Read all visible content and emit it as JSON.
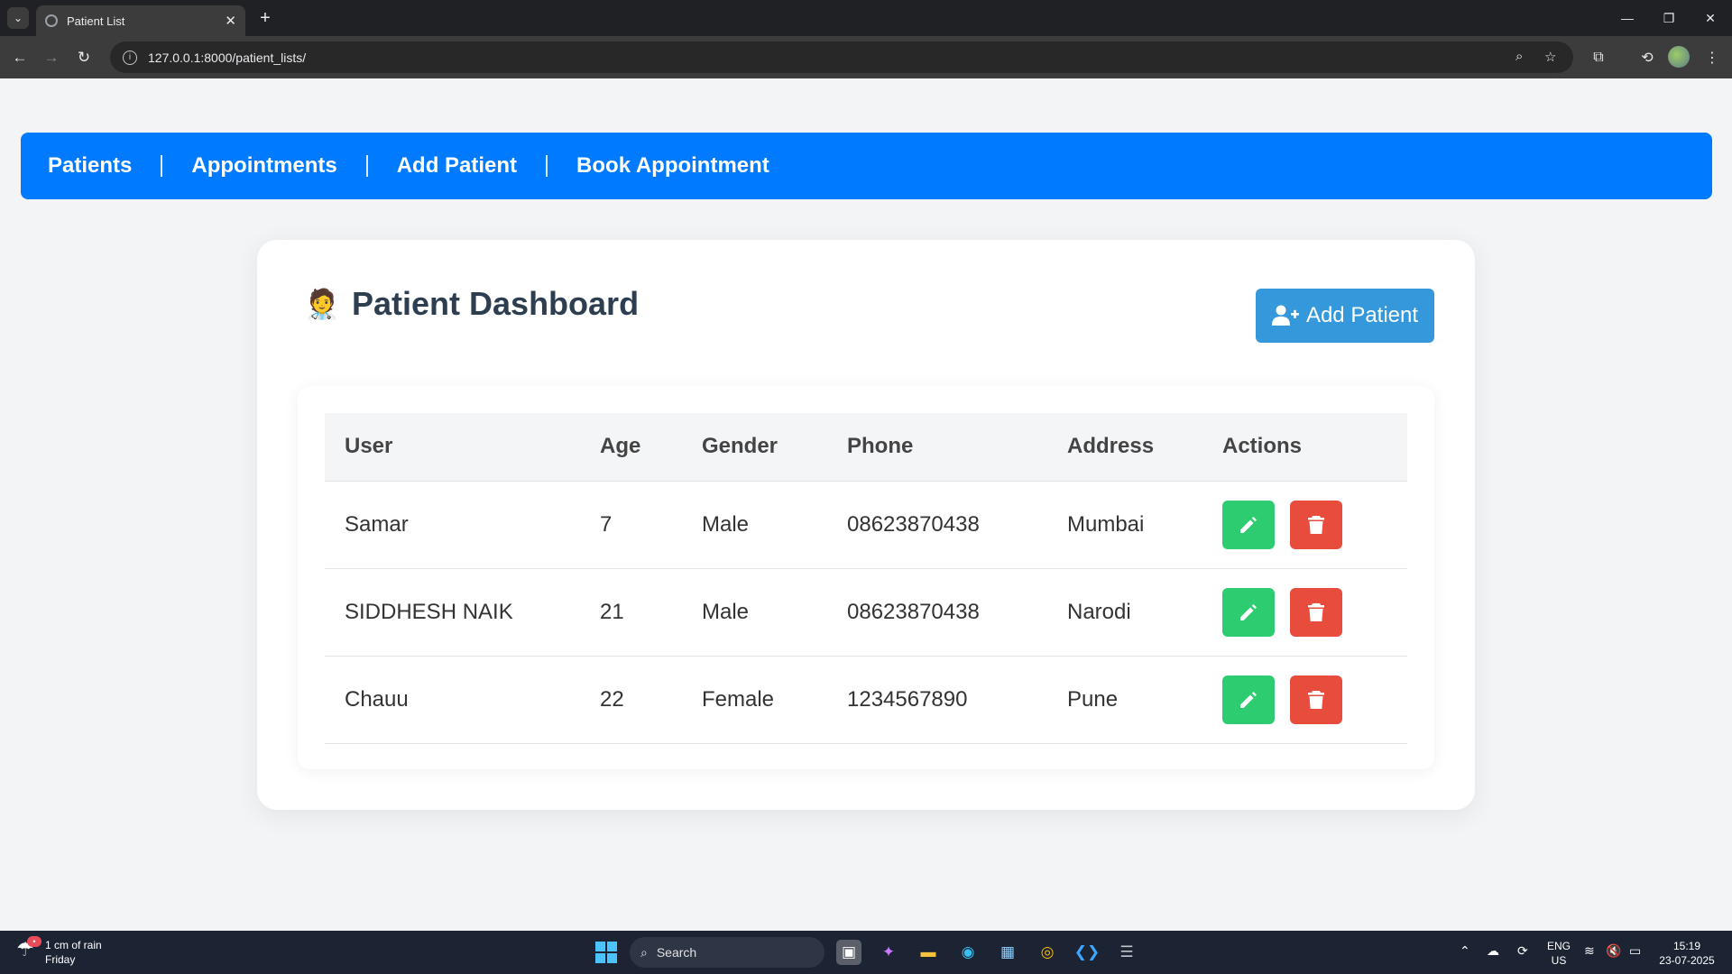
{
  "browser": {
    "tab_title": "Patient List",
    "url": "127.0.0.1:8000/patient_lists/"
  },
  "nav": {
    "items": [
      {
        "label": "Patients"
      },
      {
        "label": "Appointments"
      },
      {
        "label": "Add Patient"
      },
      {
        "label": "Book Appointment"
      }
    ]
  },
  "dashboard": {
    "emoji": "🧑‍⚕️",
    "title": "Patient Dashboard",
    "add_button": "Add Patient"
  },
  "table": {
    "headers": [
      "User",
      "Age",
      "Gender",
      "Phone",
      "Address",
      "Actions"
    ],
    "rows": [
      {
        "user": "Samar",
        "age": "7",
        "gender": "Male",
        "phone": "08623870438",
        "address": "Mumbai"
      },
      {
        "user": "SIDDHESH NAIK",
        "age": "21",
        "gender": "Male",
        "phone": "08623870438",
        "address": "Narodi"
      },
      {
        "user": "Chauu",
        "age": "22",
        "gender": "Female",
        "phone": "1234567890",
        "address": "Pune"
      }
    ]
  },
  "taskbar": {
    "weather_line1": "1 cm of rain",
    "weather_line2": "Friday",
    "search_label": "Search",
    "lang_line1": "ENG",
    "lang_line2": "US",
    "time": "15:19",
    "date": "23-07-2025"
  },
  "colors": {
    "nav_bg": "#007bff",
    "add_button": "#3498db",
    "edit_button": "#2ecc71",
    "delete_button": "#e74c3c",
    "title_text": "#2c3e50"
  }
}
